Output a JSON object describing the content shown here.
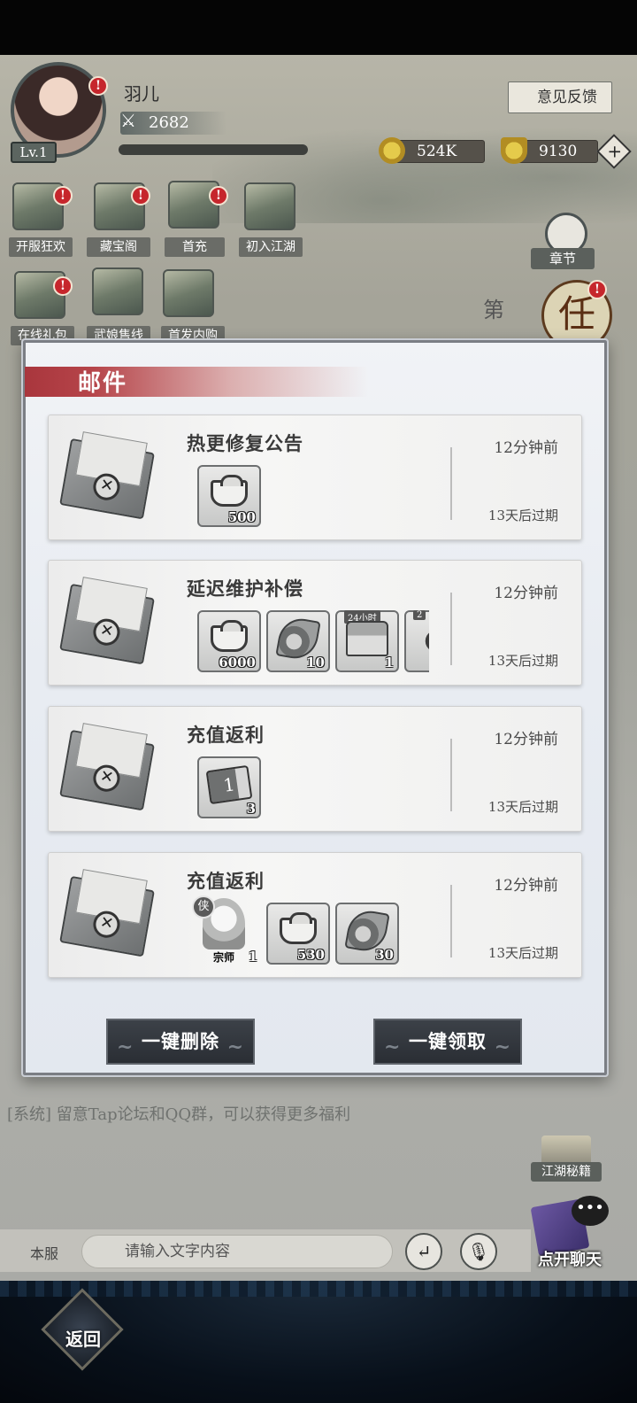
{
  "player": {
    "name": "羽儿",
    "level": "Lv.1",
    "power": "2682"
  },
  "header": {
    "feedback_label": "意见反馈",
    "coins": "524K",
    "gold": "9130",
    "plus": "+"
  },
  "menu": [
    {
      "label": "开服狂欢",
      "icon": "celebration-scroll-icon",
      "badge": "!"
    },
    {
      "label": "藏宝阁",
      "icon": "treasure-pavilion-icon",
      "badge": "!"
    },
    {
      "label": "首充",
      "icon": "gift-box-icon",
      "badge": "!"
    },
    {
      "label": "初入江湖",
      "icon": "yin-yang-icon",
      "badge": ""
    },
    {
      "label": "在线礼包",
      "icon": "online-gift-icon",
      "badge": "!"
    },
    {
      "label": "武娘售线",
      "icon": "ticket-icon",
      "badge": ""
    },
    {
      "label": "首发内购",
      "icon": "hero-portrait-icon",
      "badge": ""
    }
  ],
  "side": {
    "chapter_label": "章节",
    "task_glyph": "任",
    "task_badge": "!",
    "side_text": "第"
  },
  "mail": {
    "title": "邮件",
    "items": [
      {
        "subject": "热更修复公告",
        "time": "12分钟前",
        "expire": "13天后过期",
        "rewards": [
          {
            "icon": "silver-ingot-icon",
            "qty": "500"
          }
        ]
      },
      {
        "subject": "延迟维护补偿",
        "time": "12分钟前",
        "expire": "13天后过期",
        "rewards": [
          {
            "icon": "silver-ingot-icon",
            "qty": "6000"
          },
          {
            "icon": "leaf-token-icon",
            "qty": "10"
          },
          {
            "icon": "treasure-chest-icon",
            "qty": "1",
            "tag": "24小时"
          },
          {
            "icon": "partial-item-icon",
            "qty": "",
            "tag": "2"
          }
        ]
      },
      {
        "subject": "充值返利",
        "time": "12分钟前",
        "expire": "13天后过期",
        "rewards": [
          {
            "icon": "ticket-icon",
            "qty": "3",
            "glyph": "1"
          }
        ]
      },
      {
        "subject": "充值返利",
        "time": "12分钟前",
        "expire": "13天后过期",
        "rewards": [
          {
            "icon": "master-portrait-icon",
            "qty": "1",
            "tag": "侠",
            "name": "宗师"
          },
          {
            "icon": "silver-ingot-icon",
            "qty": "530"
          },
          {
            "icon": "leaf-token-icon",
            "qty": "30"
          }
        ]
      }
    ],
    "delete_all_label": "一键删除",
    "claim_all_label": "一键领取"
  },
  "chat": {
    "system_msg": "[系统] 留意Tap论坛和QQ群，可以获得更多福利",
    "server_label": "本服",
    "placeholder": "请输入文字内容",
    "enter_glyph": "↵",
    "mic_glyph": "🎙",
    "secret_label": "江湖秘籍",
    "open_chat_label": "点开聊天",
    "bubble_glyph": "•••"
  },
  "nav": {
    "back_label": "返回"
  },
  "colors": {
    "mail_title_band": "#a9363d",
    "button_bg": "#2f3339",
    "badge_red": "#c6262c"
  }
}
